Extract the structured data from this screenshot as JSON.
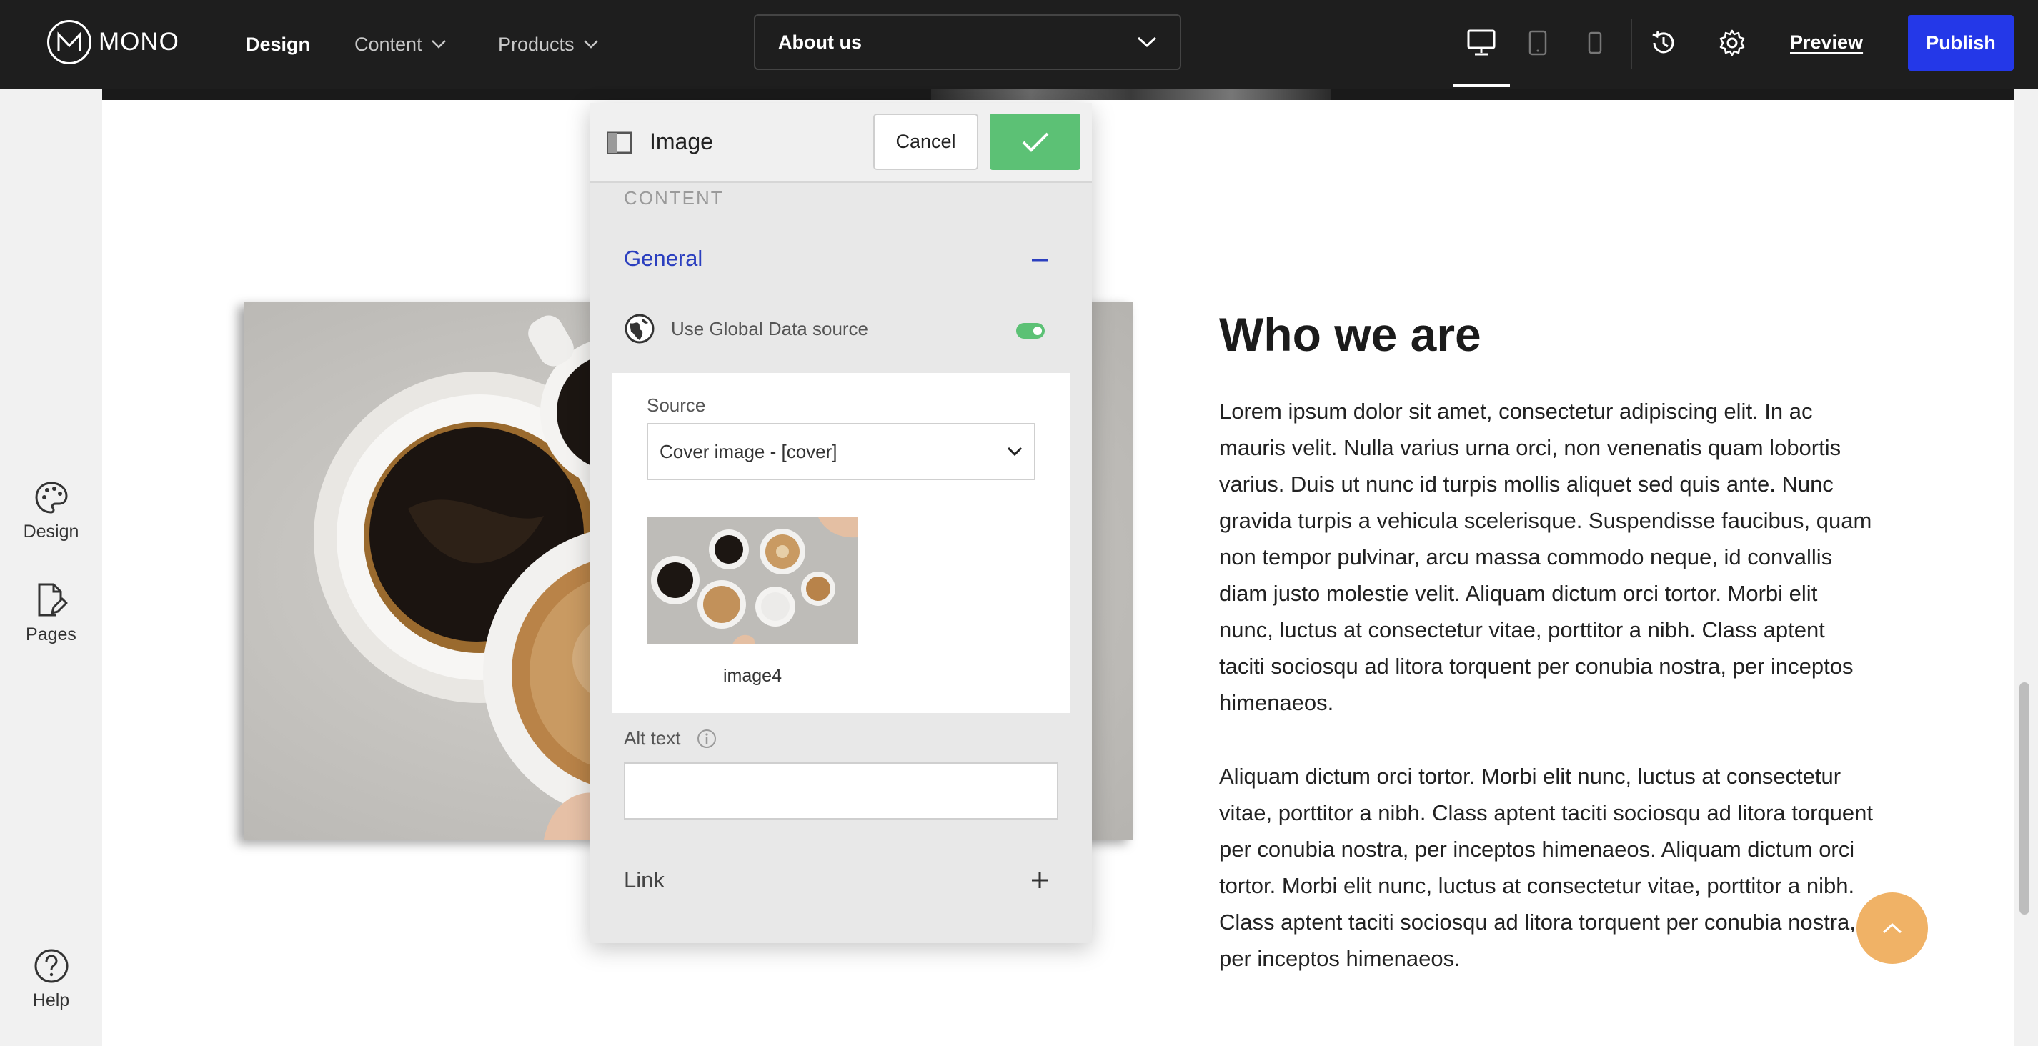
{
  "app": {
    "logo_text": "MONO",
    "nav": {
      "design": "Design",
      "content": "Content",
      "products": "Products"
    },
    "page_selector": {
      "selected": "About us"
    },
    "device_icons": [
      "desktop-icon",
      "tablet-icon",
      "mobile-icon"
    ],
    "preview": "Preview",
    "publish": "Publish",
    "colors": {
      "publish": "#2438e8",
      "confirm": "#5cc175",
      "accent_link": "#2b3fbf",
      "scroll_top": "#f0b266"
    }
  },
  "sidebar": {
    "items": [
      {
        "label": "Design",
        "icon": "palette-icon"
      },
      {
        "label": "Pages",
        "icon": "page-edit-icon"
      },
      {
        "label": "Help",
        "icon": "help-icon"
      }
    ]
  },
  "content": {
    "heading": "Who we are",
    "paragraph1": "Lorem ipsum dolor sit amet, consectetur adipiscing elit. In ac mauris velit. Nulla varius urna orci, non venenatis quam lobortis varius. Duis ut nunc id turpis mollis aliquet sed quis ante. Nunc gravida turpis a vehicula scelerisque. Suspendisse faucibus, quam non tempor pulvinar, arcu massa commodo neque, id convallis diam justo molestie velit. Aliquam dictum orci tortor. Morbi elit nunc, luctus at consectetur vitae, porttitor a nibh. Class aptent taciti sociosqu ad litora torquent per conubia nostra, per inceptos himenaeos.",
    "paragraph2": "Aliquam dictum orci tortor. Morbi elit nunc, luctus at consectetur vitae, porttitor a nibh. Class aptent taciti sociosqu ad litora torquent per conubia nostra, per inceptos himenaeos. Aliquam dictum orci tortor. Morbi elit nunc, luctus at consectetur vitae, porttitor a nibh. Class aptent taciti sociosqu ad litora torquent per conubia nostra, per inceptos himenaeos."
  },
  "panel": {
    "title": "Image",
    "cancel": "Cancel",
    "section": "CONTENT",
    "general": {
      "title": "General",
      "global_source_label": "Use Global Data source",
      "global_source_enabled": true,
      "source_label": "Source",
      "source_value": "Cover image - [cover]",
      "image_caption": "image4"
    },
    "alt_text": {
      "label": "Alt text",
      "value": ""
    },
    "link": {
      "title": "Link"
    }
  }
}
